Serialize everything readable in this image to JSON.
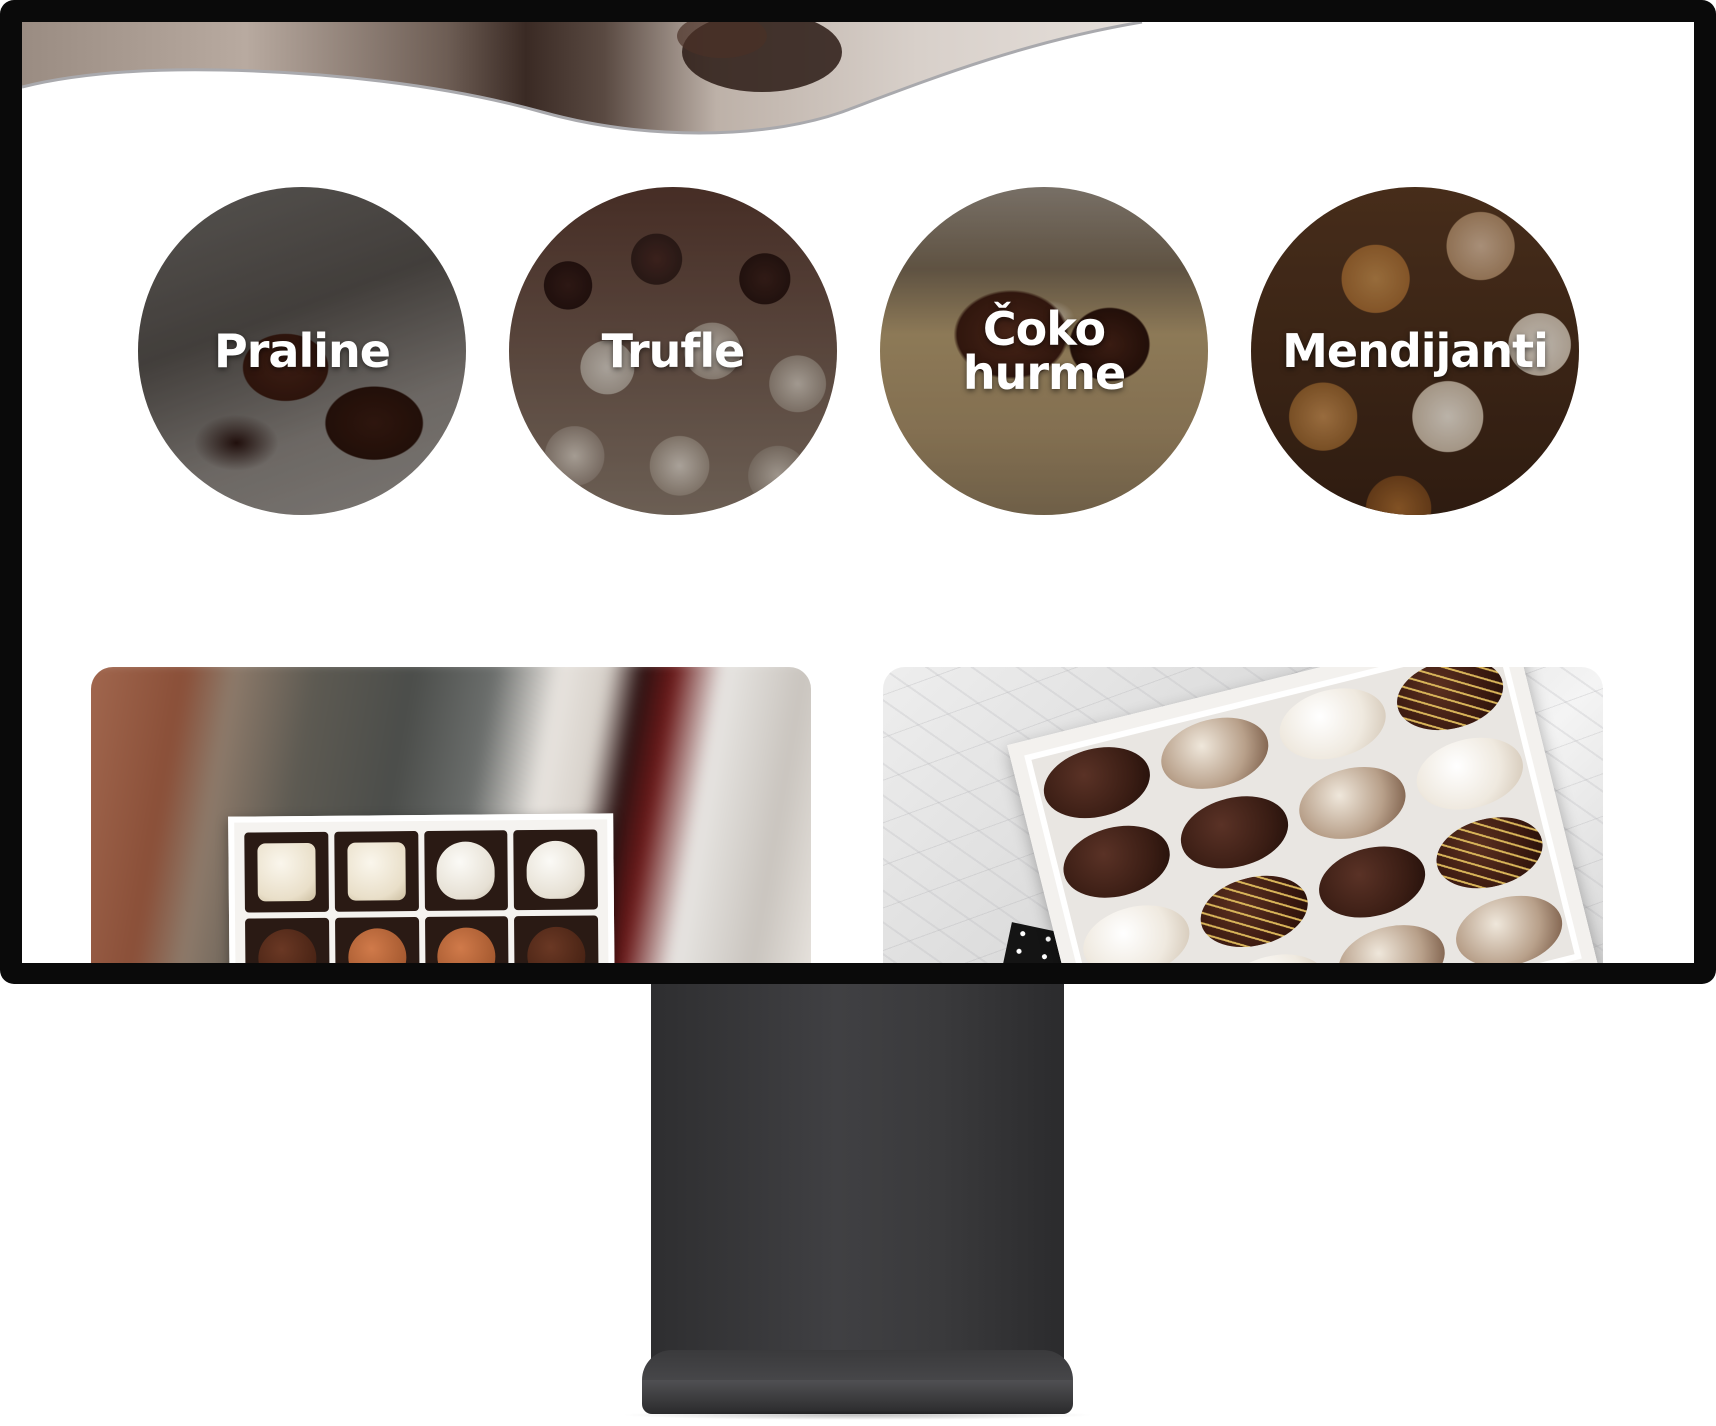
{
  "categories": [
    {
      "label": "Praline"
    },
    {
      "label": "Trufle"
    },
    {
      "label": "Čoko\nhurme"
    },
    {
      "label": "Mendijanti"
    }
  ],
  "colors": {
    "bezel": "#0a0a0a",
    "screen_background": "#ffffff",
    "stand": "#3a3a3c",
    "label_text": "#ffffff"
  }
}
